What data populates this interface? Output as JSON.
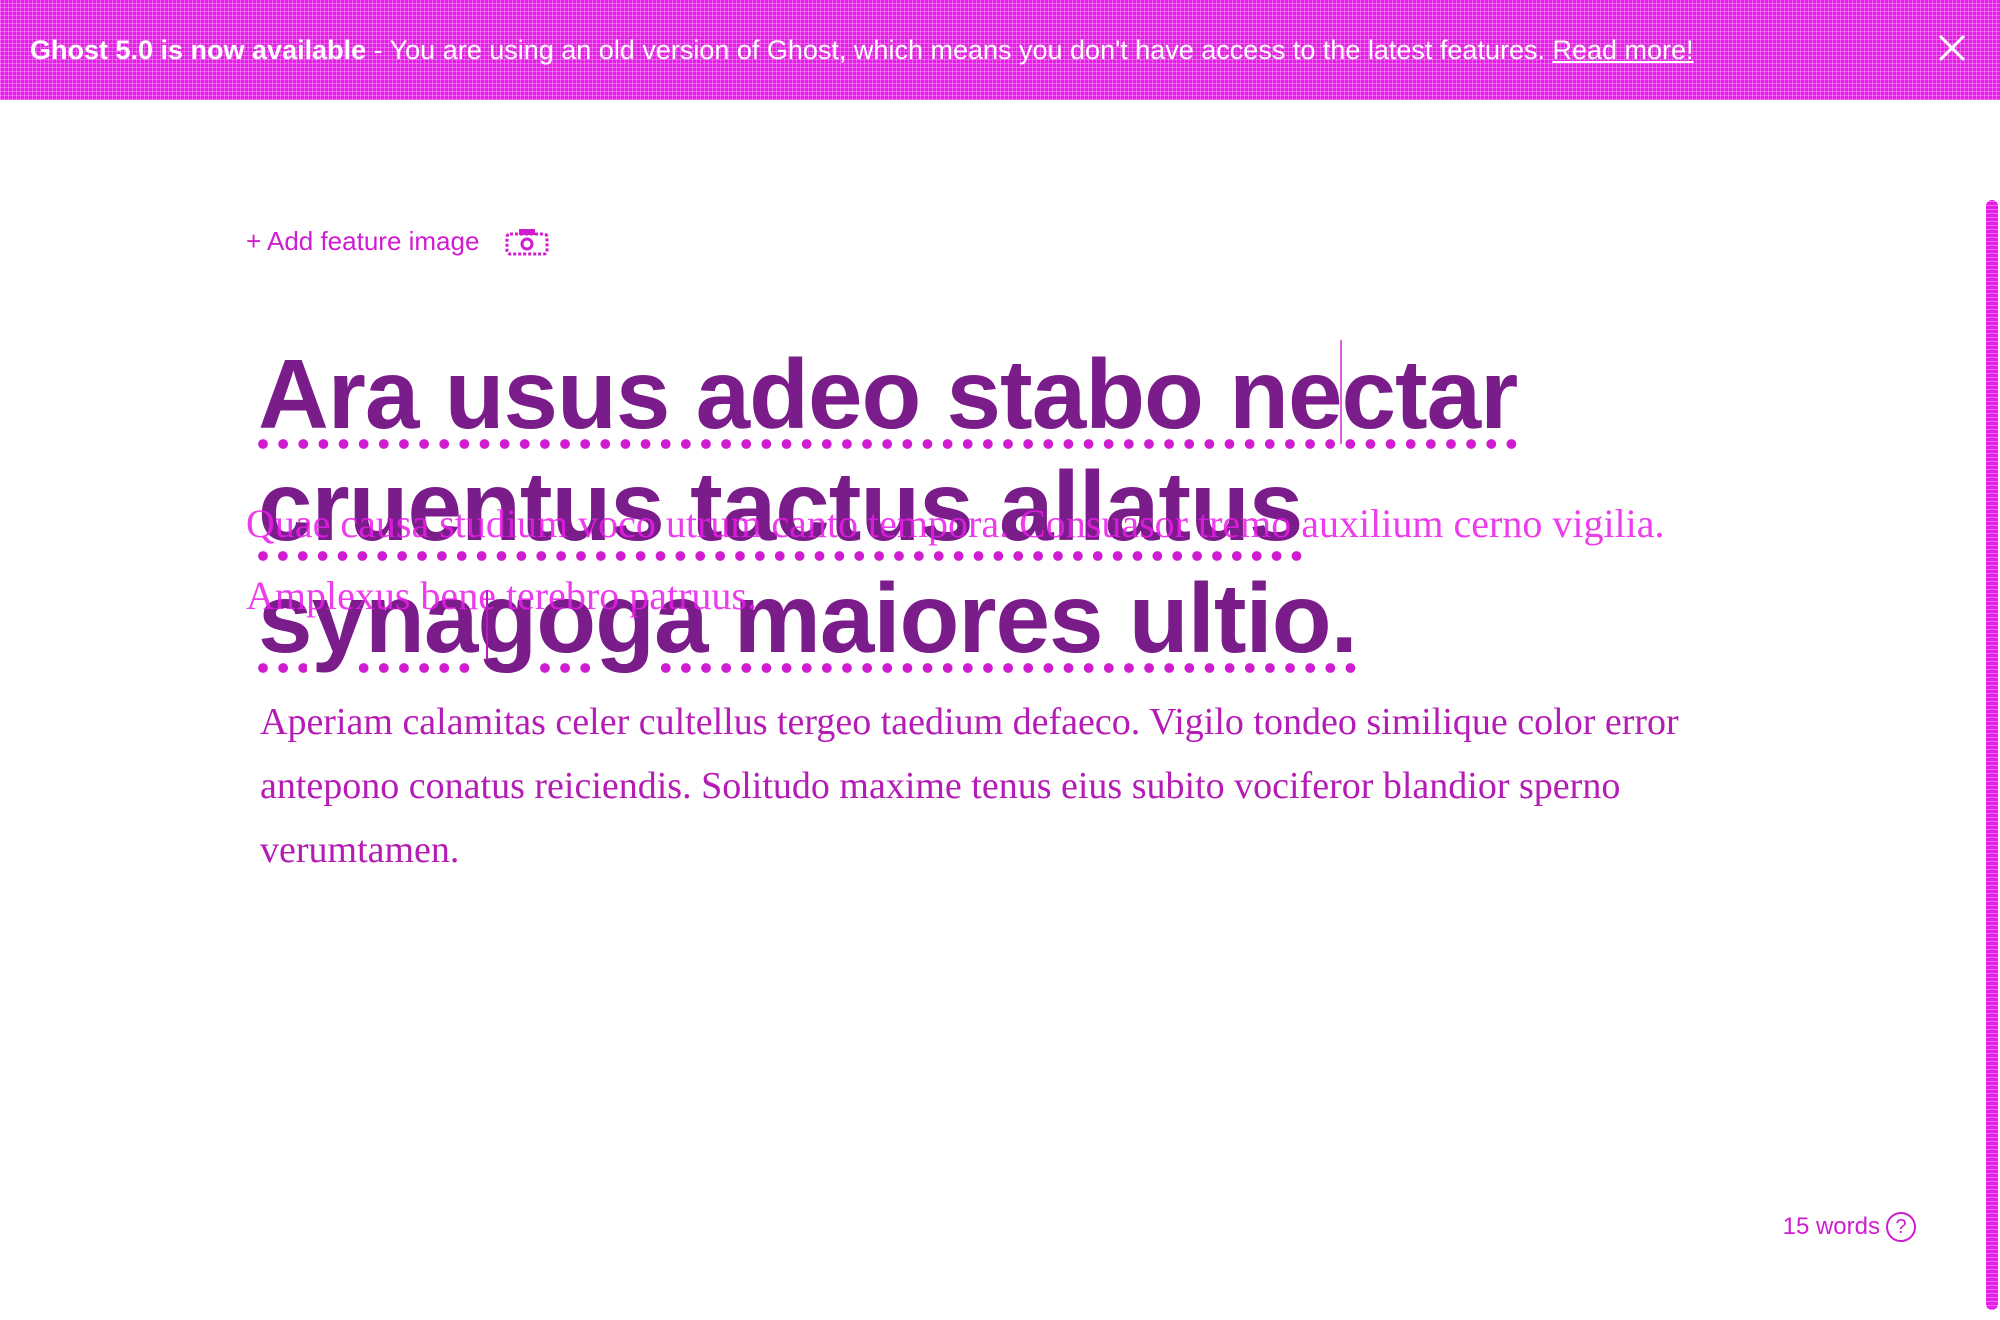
{
  "banner": {
    "headline": "Ghost 5.0 is now available",
    "message": " - You are using an old version of Ghost, which means you don't have access to the latest features. ",
    "link_label": "Read more!",
    "close_icon": "close-icon",
    "background_color": "#e81ce8"
  },
  "editor": {
    "feature_image_label": "+ Add feature image",
    "feature_image_icon": "camera-icon",
    "title": "Ara usus adeo stabo nectar cruentus tactus allatus synagoga maiores ultio.",
    "excerpt": "Quae causa studium voco utrum canto tempora. Consuasor tremo auxilium cerno vigilia. Amplexus bene terebro patruus.",
    "body": "Aperiam calamitas celer cultellus tergeo taedium defaeco. Vigilo tondeo similique color error antepono conatus reiciendis. Solitudo maxime tenus eius subito vociferor blandior sperno verumtamen."
  },
  "footer": {
    "word_count": "15 words",
    "help_icon": "help-icon",
    "help_glyph": "?"
  }
}
